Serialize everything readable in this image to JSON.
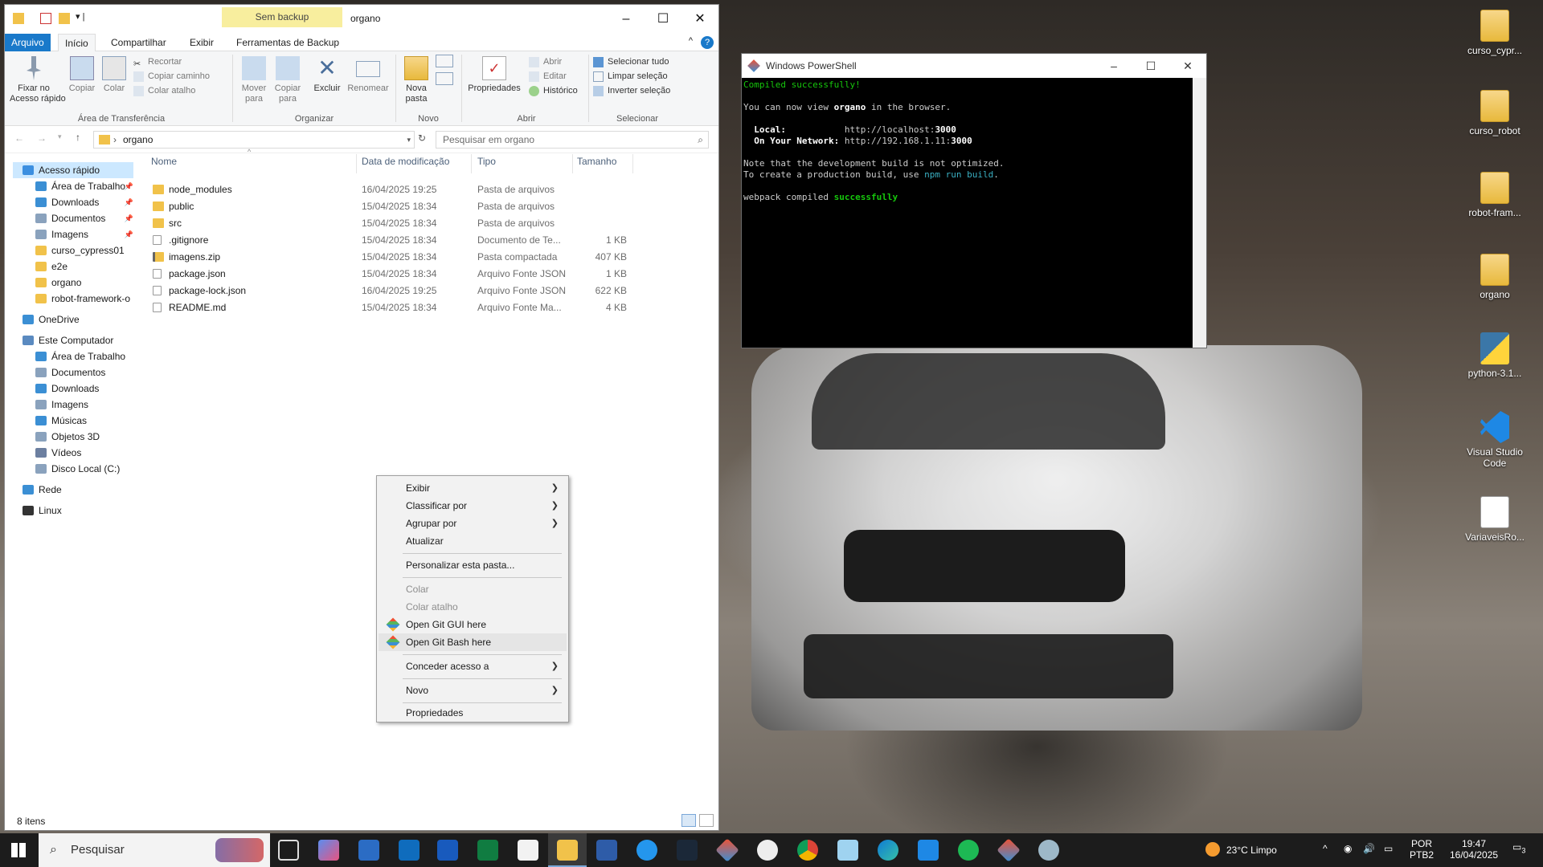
{
  "explorer": {
    "title": "organo",
    "contextual_tab": "Sem backup",
    "tabs": [
      "Arquivo",
      "Início",
      "Compartilhar",
      "Exibir",
      "Ferramentas de Backup"
    ],
    "ribbon": {
      "pin": "Fixar no\nAcesso rápido",
      "copy": "Copiar",
      "paste": "Colar",
      "cut": "Recortar",
      "copy_path": "Copiar caminho",
      "paste_shortcut": "Colar atalho",
      "group_clipboard": "Área de Transferência",
      "move_to": "Mover\npara",
      "copy_to": "Copiar\npara",
      "delete": "Excluir",
      "rename": "Renomear",
      "group_organize": "Organizar",
      "new_folder": "Nova\npasta",
      "group_new": "Novo",
      "properties": "Propriedades",
      "open": "Abrir",
      "edit": "Editar",
      "history": "Histórico",
      "group_open": "Abrir",
      "select_all": "Selecionar tudo",
      "select_none": "Limpar seleção",
      "invert": "Inverter seleção",
      "group_select": "Selecionar"
    },
    "address": "organo",
    "search_placeholder": "Pesquisar em organo",
    "columns": [
      "Nome",
      "Data de modificação",
      "Tipo",
      "Tamanho"
    ],
    "files": [
      {
        "name": "node_modules",
        "date": "16/04/2025 19:25",
        "type": "Pasta de arquivos",
        "size": "",
        "kind": "folder"
      },
      {
        "name": "public",
        "date": "15/04/2025 18:34",
        "type": "Pasta de arquivos",
        "size": "",
        "kind": "folder"
      },
      {
        "name": "src",
        "date": "15/04/2025 18:34",
        "type": "Pasta de arquivos",
        "size": "",
        "kind": "folder"
      },
      {
        "name": ".gitignore",
        "date": "15/04/2025 18:34",
        "type": "Documento de Te...",
        "size": "1 KB",
        "kind": "file"
      },
      {
        "name": "imagens.zip",
        "date": "15/04/2025 18:34",
        "type": "Pasta compactada",
        "size": "407 KB",
        "kind": "zip"
      },
      {
        "name": "package.json",
        "date": "15/04/2025 18:34",
        "type": "Arquivo Fonte JSON",
        "size": "1 KB",
        "kind": "file"
      },
      {
        "name": "package-lock.json",
        "date": "16/04/2025 19:25",
        "type": "Arquivo Fonte JSON",
        "size": "622 KB",
        "kind": "file"
      },
      {
        "name": "README.md",
        "date": "15/04/2025 18:34",
        "type": "Arquivo Fonte Ma...",
        "size": "4 KB",
        "kind": "file"
      }
    ],
    "nav": [
      {
        "label": "Acesso rápido",
        "pin": false
      },
      {
        "label": "Área de Trabalho",
        "pin": true
      },
      {
        "label": "Downloads",
        "pin": true
      },
      {
        "label": "Documentos",
        "pin": true
      },
      {
        "label": "Imagens",
        "pin": true
      },
      {
        "label": "curso_cypress01",
        "pin": false
      },
      {
        "label": "e2e",
        "pin": false
      },
      {
        "label": "organo",
        "pin": false
      },
      {
        "label": "robot-framework-o",
        "pin": false
      },
      {
        "label": "OneDrive",
        "pin": false
      },
      {
        "label": "Este Computador",
        "pin": false
      },
      {
        "label": "Área de Trabalho",
        "pin": false
      },
      {
        "label": "Documentos",
        "pin": false
      },
      {
        "label": "Downloads",
        "pin": false
      },
      {
        "label": "Imagens",
        "pin": false
      },
      {
        "label": "Músicas",
        "pin": false
      },
      {
        "label": "Objetos 3D",
        "pin": false
      },
      {
        "label": "Vídeos",
        "pin": false
      },
      {
        "label": "Disco Local (C:)",
        "pin": false
      },
      {
        "label": "Rede",
        "pin": false
      },
      {
        "label": "Linux",
        "pin": false
      }
    ],
    "status": "8 itens"
  },
  "context_menu": {
    "items": [
      "Exibir",
      "Classificar por",
      "Agrupar por",
      "Atualizar",
      "Personalizar esta pasta...",
      "Colar",
      "Colar atalho",
      "Open Git GUI here",
      "Open Git Bash here",
      "Conceder acesso a",
      "Novo",
      "Propriedades"
    ]
  },
  "powershell": {
    "title": "Windows PowerShell",
    "line1": "Compiled successfully!",
    "line2a": "You can now view ",
    "line2b": "organo",
    "line2c": " in the browser.",
    "local_label": "  Local:",
    "local_url": "http://localhost:",
    "local_port": "3000",
    "network_label": "  On Your Network:",
    "network_url": "http://192.168.1.11:",
    "network_port": "3000",
    "note1": "Note that the development build is not optimized.",
    "note2a": "To create a production build, use ",
    "note2b": "npm run build",
    "note2c": ".",
    "webpack_a": "webpack compiled ",
    "webpack_b": "successfully"
  },
  "desktop_icons": [
    "curso_cypr...",
    "curso_robot",
    "robot-fram...",
    "organo",
    "python-3.1...",
    "Visual Studio Code",
    "VariaveisRo..."
  ],
  "taskbar": {
    "search": "Pesquisar",
    "weather": "23°C  Limpo",
    "lang1": "POR",
    "lang2": "PTB2",
    "time": "19:47",
    "date": "16/04/2025",
    "notif_count": "3"
  }
}
